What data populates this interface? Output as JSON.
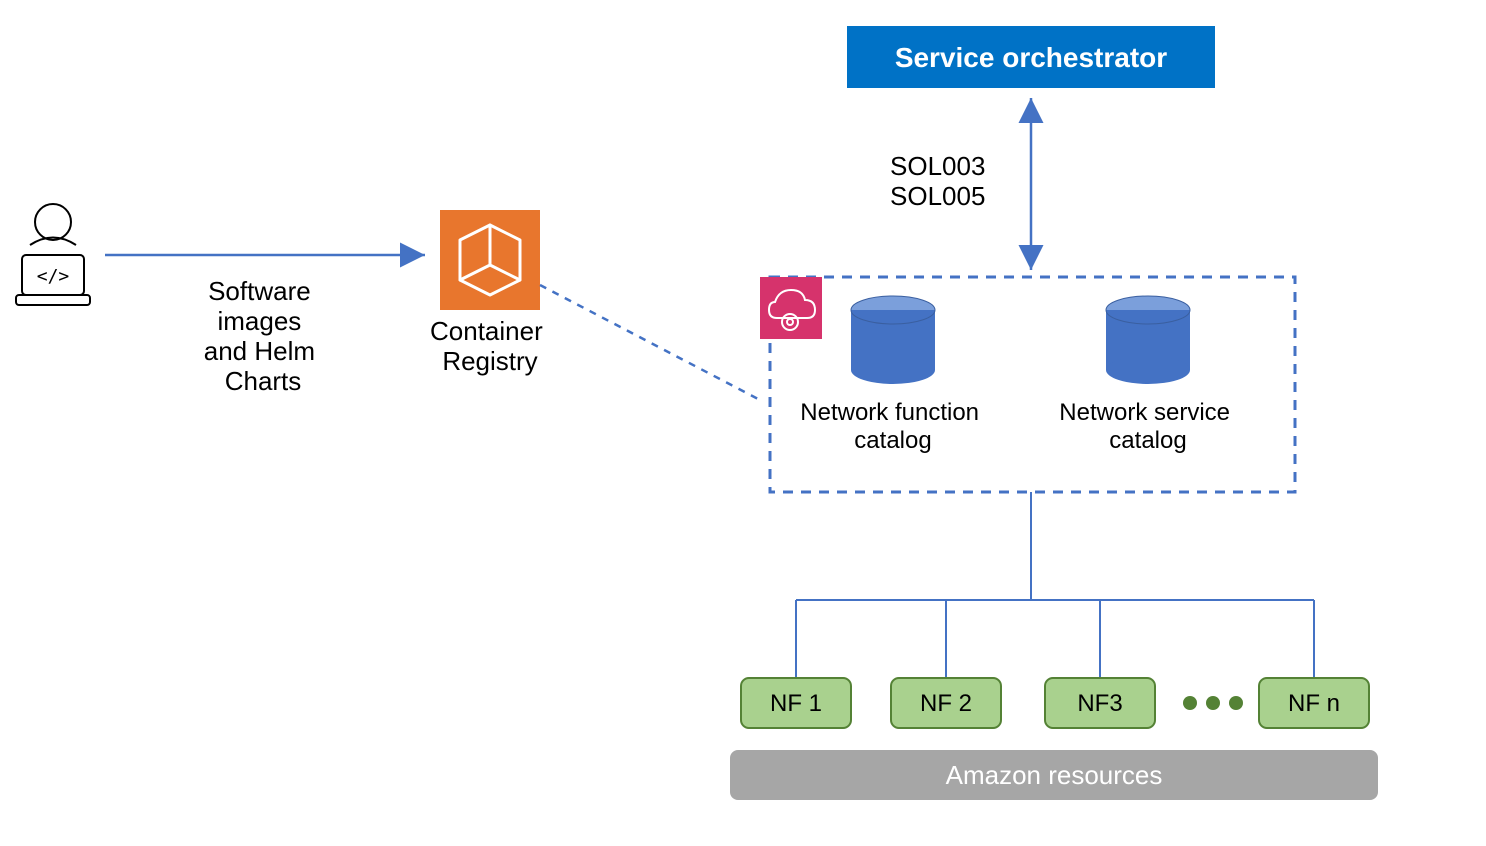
{
  "labels": {
    "software_images_l1": "Software",
    "software_images_l2": "images",
    "software_images_l3": "and Helm",
    "software_images_l4": "Charts",
    "container_registry_l1": "Container",
    "container_registry_l2": "Registry",
    "service_orchestrator": "Service orchestrator",
    "sol003": "SOL003",
    "sol005": "SOL005",
    "nf_catalog_l1": "Network function",
    "nf_catalog_l2": "catalog",
    "ns_catalog_l1": "Network service",
    "ns_catalog_l2": "catalog",
    "nf1": "NF 1",
    "nf2": "NF 2",
    "nf3": "NF3",
    "nfn": "NF n",
    "amazon_resources": "Amazon resources"
  },
  "colors": {
    "blue": "#4472C4",
    "orange": "#E8762D",
    "magenta": "#D6336C",
    "green": "#A9D18E",
    "greenborder": "#548235",
    "grey": "#A6A6A6",
    "box_blue": "#0072C6",
    "cyl_top": "#7B9FDB",
    "cyl_body": "#4472C4"
  }
}
